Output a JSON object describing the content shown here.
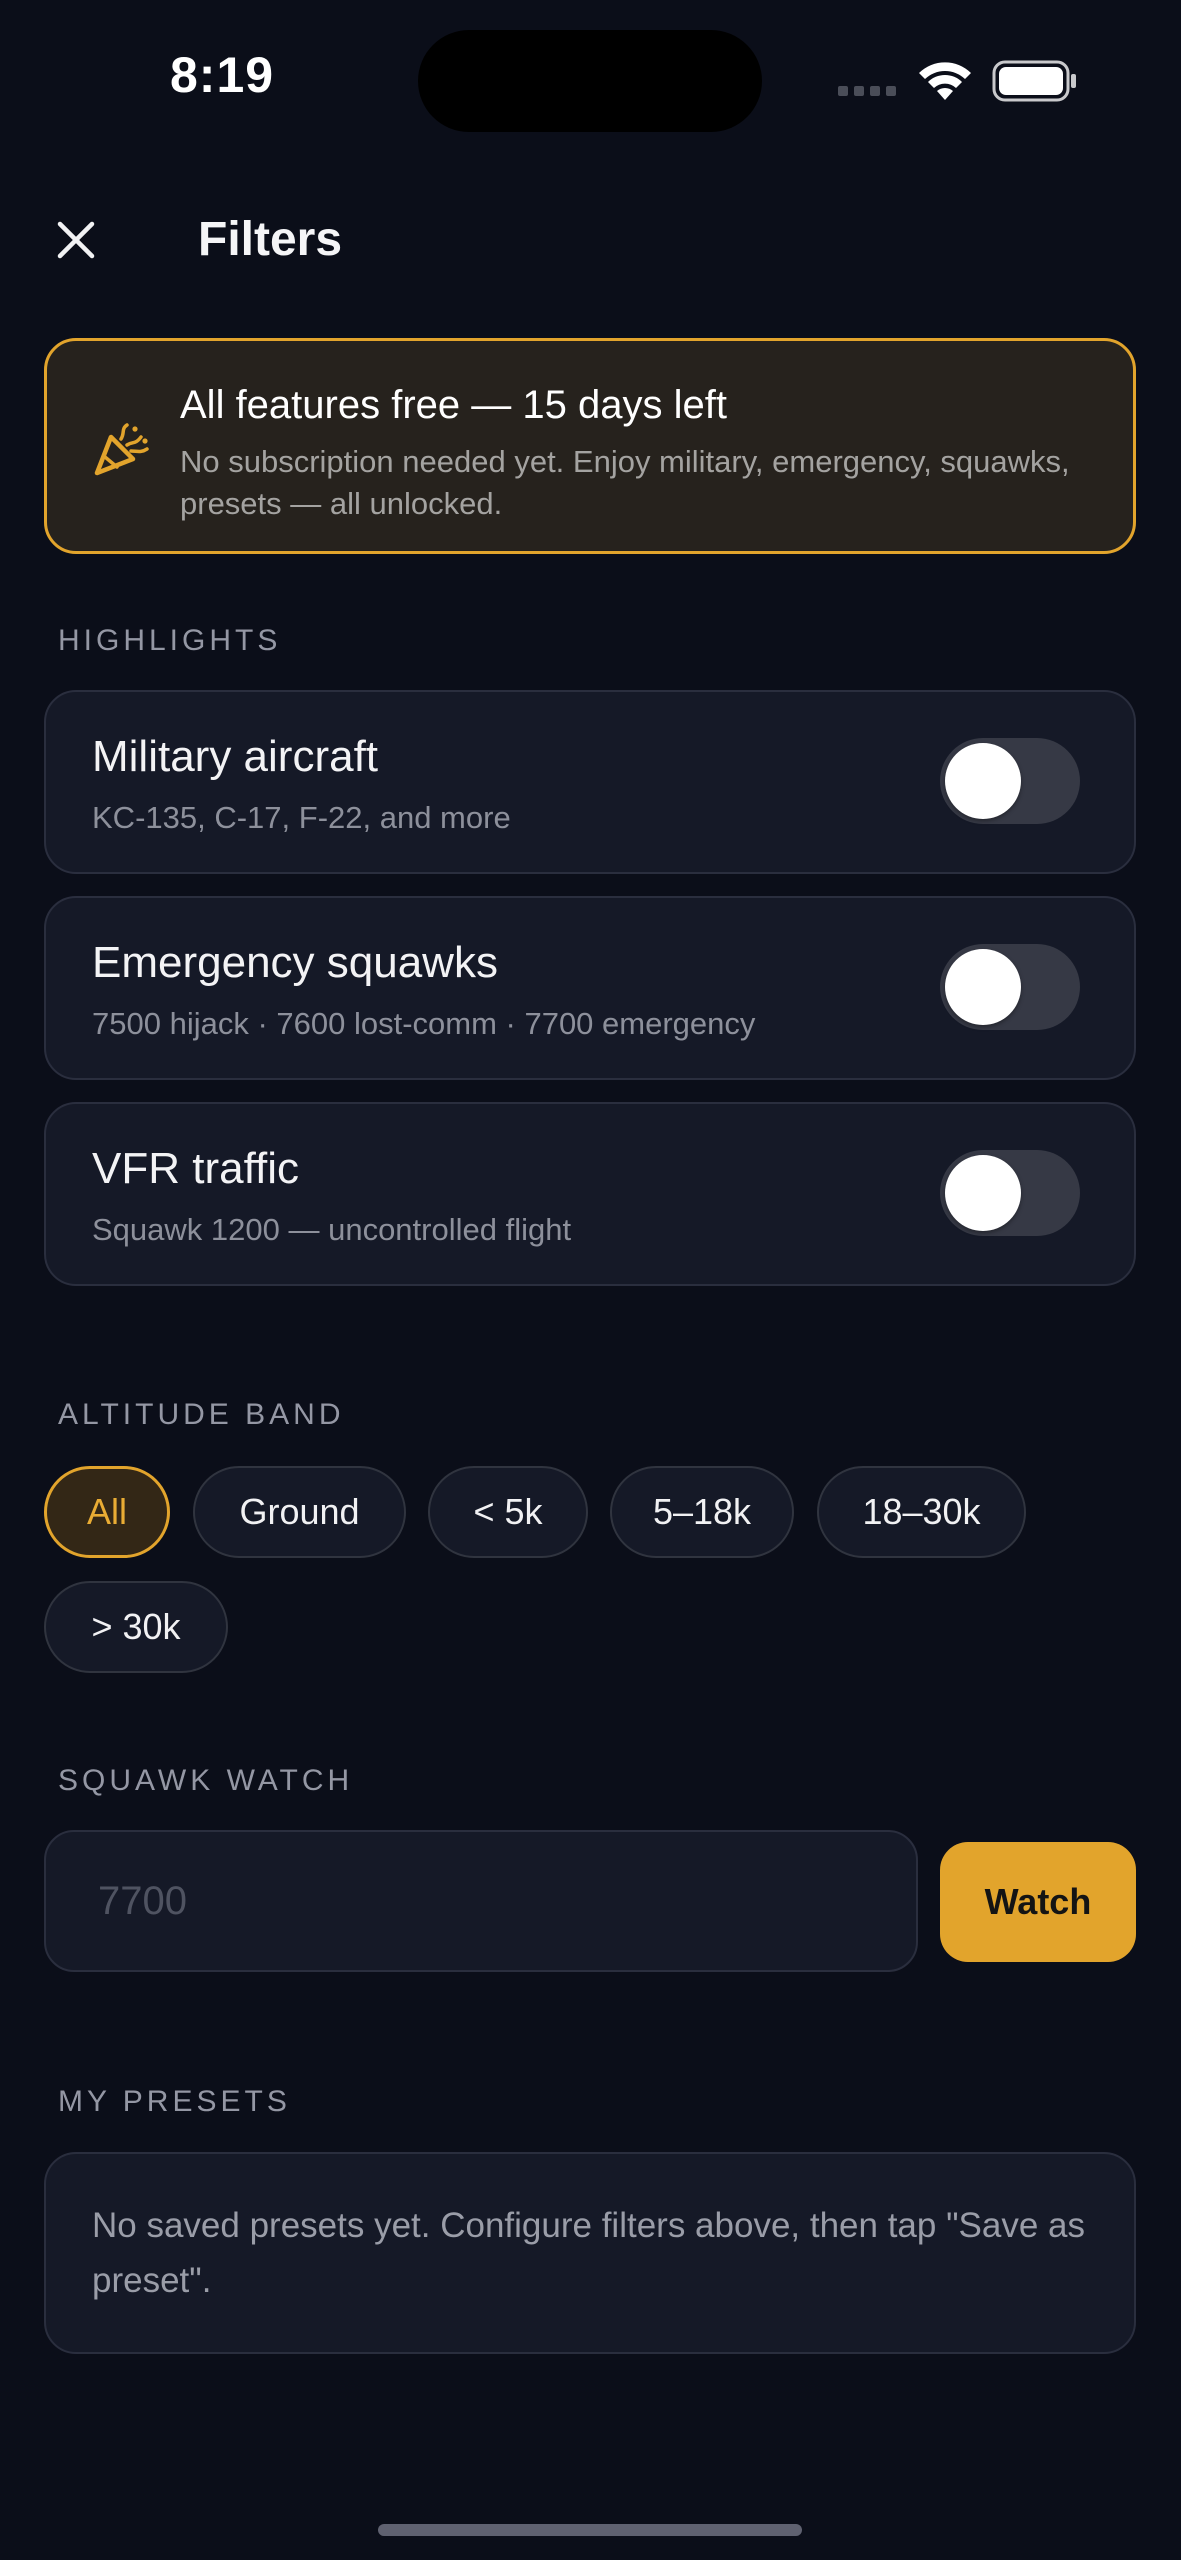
{
  "status_bar": {
    "time": "8:19"
  },
  "header": {
    "title": "Filters",
    "close_icon": "close-icon"
  },
  "trial_banner": {
    "icon": "party-popper-icon",
    "title": "All features free — 15 days left",
    "text": "No subscription needed yet. Enjoy military, emergency, squawks, presets — all unlocked.",
    "accent_color": "#e2a42c"
  },
  "highlights": {
    "label": "HIGHLIGHTS",
    "items": [
      {
        "title": "Military aircraft",
        "subtitle": "KC-135, C-17, F-22, and more",
        "enabled": false
      },
      {
        "title": "Emergency squawks",
        "subtitle": "7500 hijack · 7600 lost-comm · 7700 emergency",
        "enabled": false
      },
      {
        "title": "VFR traffic",
        "subtitle": "Squawk 1200 — uncontrolled flight",
        "enabled": false
      }
    ]
  },
  "altitude_band": {
    "label": "ALTITUDE BAND",
    "options": [
      "All",
      "Ground",
      "< 5k",
      "5–18k",
      "18–30k",
      "> 30k"
    ],
    "selected": "All"
  },
  "squawk_watch": {
    "label": "SQUAWK WATCH",
    "placeholder": "7700",
    "value": "",
    "button_label": "Watch"
  },
  "presets": {
    "label": "MY PRESETS",
    "empty_text": "No saved presets yet. Configure filters above, then tap \"Save as preset\"."
  }
}
